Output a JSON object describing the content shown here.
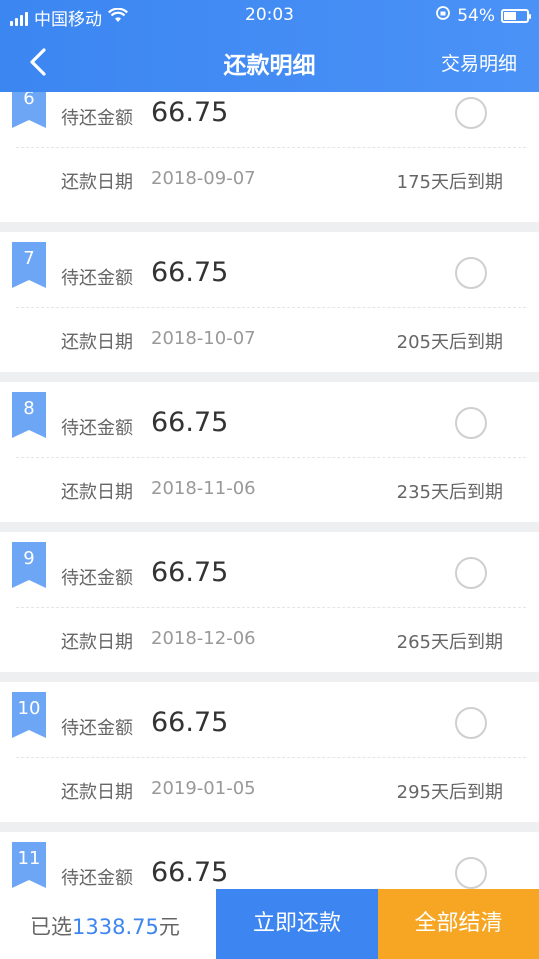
{
  "status_bar": {
    "carrier": "中国移动",
    "time": "20:03",
    "battery_text": "54%",
    "battery_level": 0.54
  },
  "nav": {
    "title": "还款明细",
    "right_link": "交易明细"
  },
  "labels": {
    "amount_label": "待还金额",
    "date_label": "还款日期"
  },
  "installments": [
    {
      "index": "6",
      "amount": "66.75",
      "date": "2018-09-07",
      "due": "175天后到期"
    },
    {
      "index": "7",
      "amount": "66.75",
      "date": "2018-10-07",
      "due": "205天后到期"
    },
    {
      "index": "8",
      "amount": "66.75",
      "date": "2018-11-06",
      "due": "235天后到期"
    },
    {
      "index": "9",
      "amount": "66.75",
      "date": "2018-12-06",
      "due": "265天后到期"
    },
    {
      "index": "10",
      "amount": "66.75",
      "date": "2019-01-05",
      "due": "295天后到期"
    },
    {
      "index": "11",
      "amount": "66.75",
      "date": "",
      "due": ""
    }
  ],
  "footer": {
    "selected_prefix": "已选",
    "selected_amount": "1338.75",
    "selected_suffix": "元",
    "pay_now": "立即还款",
    "pay_all": "全部结清"
  },
  "colors": {
    "header_blue": "#3d86f1",
    "tag_blue": "#6ea6f6",
    "orange": "#f6a623"
  }
}
